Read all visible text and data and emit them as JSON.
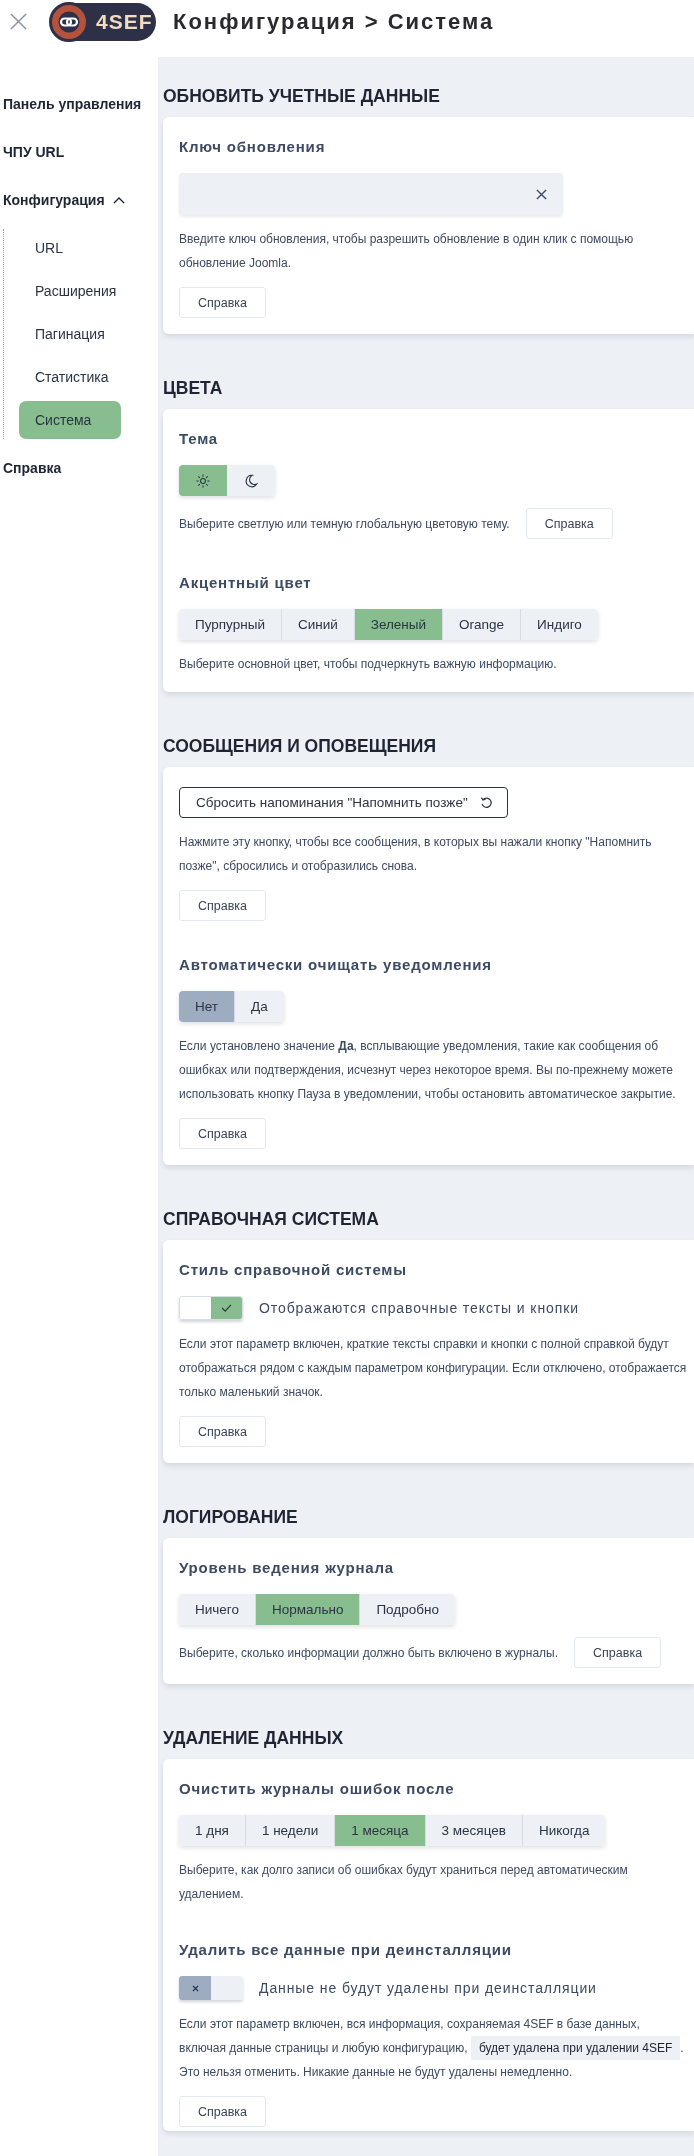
{
  "header": {
    "logo_text": "4SEF",
    "title": "Конфигурация > Система"
  },
  "sidebar": {
    "items": [
      {
        "label": "Панель управления",
        "selected": false
      },
      {
        "label": "ЧПУ URL",
        "selected": false
      },
      {
        "label": "Конфигурация",
        "selected": false,
        "expanded": true,
        "children": [
          {
            "label": "URL",
            "selected": false
          },
          {
            "label": "Расширения",
            "selected": false
          },
          {
            "label": "Пагинация",
            "selected": false
          },
          {
            "label": "Статистика",
            "selected": false
          },
          {
            "label": "Система",
            "selected": true
          }
        ]
      },
      {
        "label": "Справка",
        "selected": false
      }
    ]
  },
  "sections": [
    {
      "title": "ОБНОВИТЬ УЧЕТНЫЕ ДАННЫЕ",
      "fields": [
        {
          "label": "Ключ обновления",
          "control": {
            "kind": "input",
            "clearable": true
          },
          "description": "Введите ключ обновления, чтобы разрешить обновление в один клик с помощью обновление Joomla.",
          "help": "Справка"
        }
      ]
    },
    {
      "title": "ЦВЕТА",
      "fields": [
        {
          "label": "Тема",
          "control": {
            "kind": "icons",
            "options": [
              {
                "kind": "light",
                "selected": true
              },
              {
                "kind": "dark",
                "selected": false
              }
            ]
          },
          "description": "Выберите светлую или темную глобальную цветовую тему.",
          "help": "Справка"
        },
        {
          "label": "Акцентный цвет",
          "control": {
            "kind": "segmented",
            "options": [
              {
                "label": "Пурпурный",
                "selected": false
              },
              {
                "label": "Синий",
                "selected": false
              },
              {
                "label": "Зеленый",
                "selected": true
              },
              {
                "label": "Orange",
                "selected": false
              },
              {
                "label": "Индиго",
                "selected": false
              }
            ]
          },
          "description": "Выберите основной цвет, чтобы подчеркнуть важную информацию."
        }
      ]
    },
    {
      "title": "СООБЩЕНИЯ И ОПОВЕЩЕНИЯ",
      "fields": [
        {
          "control": {
            "kind": "button",
            "label": "Сбросить напоминания \"Напомнить позже\""
          },
          "description": "Нажмите эту кнопку, чтобы все сообщения, в которых вы нажали кнопку \"Напомнить позже\", сбросились и отобразились снова.",
          "help": "Справка"
        },
        {
          "label": "Автоматически очищать уведомления",
          "control": {
            "kind": "yesno",
            "options": [
              {
                "label": "Нет",
                "selected": true
              },
              {
                "label": "Да",
                "selected": false
              }
            ]
          },
          "description": "Если установлено значение **Да**, всплывающие уведомления, такие как сообщения об ошибках или подтверждения, исчезнут через некоторое время. Вы по-прежнему можете использовать кнопку Пауза в уведомлении, чтобы остановить автоматическое закрытие.",
          "help": "Справка"
        }
      ]
    },
    {
      "title": "СПРАВОЧНАЯ СИСТЕМА",
      "fields": [
        {
          "label": "Стиль справочной системы",
          "control": {
            "kind": "switch",
            "on": true,
            "text": "Отображаются справочные тексты и кнопки"
          },
          "description": "Если этот параметр включен, краткие тексты справки и кнопки с полной справкой будут отображаться рядом с каждым параметром конфигурации. Если отключено, отображается только маленький значок.",
          "help": "Справка"
        }
      ]
    },
    {
      "title": "ЛОГИРОВАНИЕ",
      "fields": [
        {
          "label": "Уровень ведения журнала",
          "control": {
            "kind": "segmented",
            "options": [
              {
                "label": "Ничего",
                "selected": false
              },
              {
                "label": "Нормально",
                "selected": true
              },
              {
                "label": "Подробно",
                "selected": false
              }
            ]
          },
          "description": "Выберите, сколько информации должно быть включено в журналы.",
          "help": "Справка"
        }
      ]
    },
    {
      "title": "УДАЛЕНИЕ ДАННЫХ",
      "fields": [
        {
          "label": "Очистить журналы ошибок после",
          "control": {
            "kind": "segmented",
            "options": [
              {
                "label": "1 дня",
                "selected": false
              },
              {
                "label": "1 недели",
                "selected": false
              },
              {
                "label": "1 месяца",
                "selected": true
              },
              {
                "label": "3 месяцев",
                "selected": false
              },
              {
                "label": "Никогда",
                "selected": false
              }
            ]
          },
          "description": "Выберите, как долго записи об ошибках будут храниться перед автоматическим удалением."
        },
        {
          "label": "Удалить все данные при деинсталляции",
          "control": {
            "kind": "switch",
            "on": false,
            "text": "Данные не будут удалены при деинсталляции"
          },
          "description_parts": [
            {
              "kind": "text",
              "text": "Если этот параметр включен, вся информация, сохраняемая 4SEF в базе данных, включая данные страницы и любую конфигурацию, "
            },
            {
              "kind": "code",
              "text": "будет удалена при удалении 4SEF"
            },
            {
              "kind": "text",
              "text": ". Это нельзя отменить. Никакие данные не будут удалены немедленно."
            }
          ],
          "help": "Справка"
        }
      ]
    }
  ]
}
